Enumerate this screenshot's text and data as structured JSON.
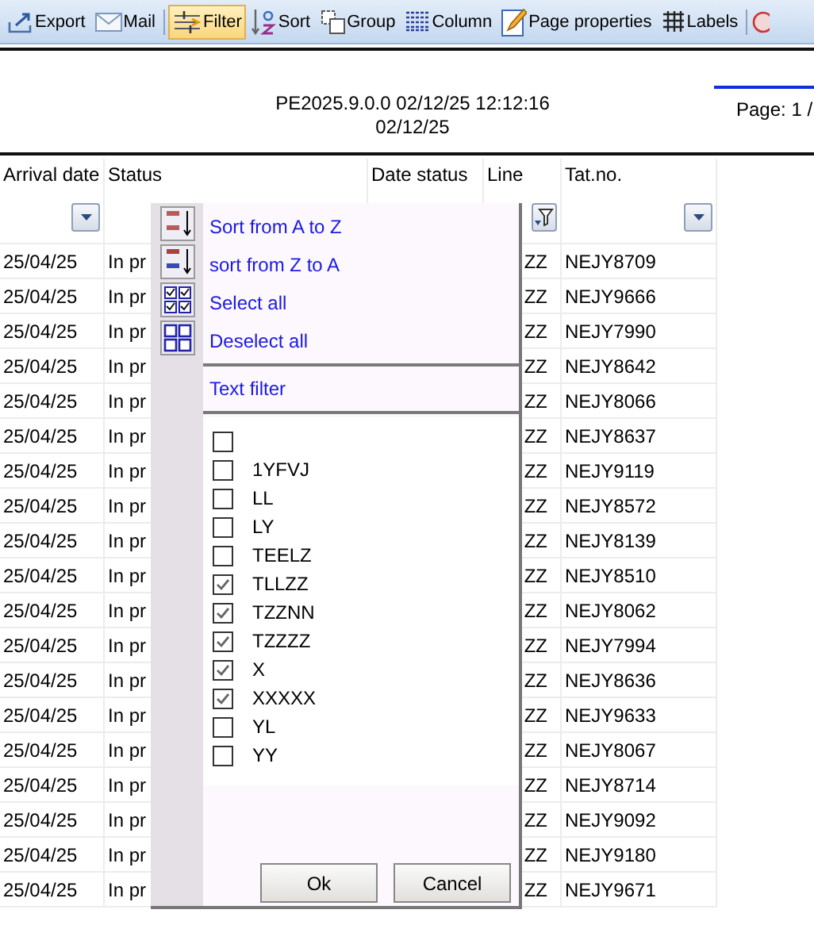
{
  "toolbar": {
    "items": [
      {
        "label": "Export",
        "selected": false
      },
      {
        "label": "Mail",
        "selected": false
      },
      {
        "label": "Filter",
        "selected": true
      },
      {
        "label": "Sort",
        "selected": false
      },
      {
        "label": "Group",
        "selected": false
      },
      {
        "label": "Column",
        "selected": false
      },
      {
        "label": "Page properties",
        "selected": false
      },
      {
        "label": "Labels",
        "selected": false
      }
    ]
  },
  "report_header": {
    "version_line": "PE2025.9.0.0  02/12/25 12:12:16",
    "date": "02/12/25",
    "page": "Page: 1 /"
  },
  "table": {
    "columns": [
      {
        "label": "Arrival date",
        "filter_active": false
      },
      {
        "label": "Status"
      },
      {
        "label": "Date status"
      },
      {
        "label": "Line",
        "filter_active": true
      },
      {
        "label": "Tat.no.",
        "filter_active": false
      }
    ],
    "rows": [
      {
        "arrival": "25/04/25",
        "status": "In pr",
        "line": "ZZ",
        "tat_no": "NEJY8709"
      },
      {
        "arrival": "25/04/25",
        "status": "In pr",
        "line": "ZZ",
        "tat_no": "NEJY9666"
      },
      {
        "arrival": "25/04/25",
        "status": "In pr",
        "line": "ZZ",
        "tat_no": "NEJY7990"
      },
      {
        "arrival": "25/04/25",
        "status": "In pr",
        "line": "ZZ",
        "tat_no": "NEJY8642"
      },
      {
        "arrival": "25/04/25",
        "status": "In pr",
        "line": "ZZ",
        "tat_no": "NEJY8066"
      },
      {
        "arrival": "25/04/25",
        "status": "In pr",
        "line": "ZZ",
        "tat_no": "NEJY8637"
      },
      {
        "arrival": "25/04/25",
        "status": "In pr",
        "line": "ZZ",
        "tat_no": "NEJY9119"
      },
      {
        "arrival": "25/04/25",
        "status": "In pr",
        "line": "ZZ",
        "tat_no": "NEJY8572"
      },
      {
        "arrival": "25/04/25",
        "status": "In pr",
        "line": "ZZ",
        "tat_no": "NEJY8139"
      },
      {
        "arrival": "25/04/25",
        "status": "In pr",
        "line": "ZZ",
        "tat_no": "NEJY8510"
      },
      {
        "arrival": "25/04/25",
        "status": "In pr",
        "line": "ZZ",
        "tat_no": "NEJY8062"
      },
      {
        "arrival": "25/04/25",
        "status": "In pr",
        "line": "ZZ",
        "tat_no": "NEJY7994"
      },
      {
        "arrival": "25/04/25",
        "status": "In pr",
        "line": "ZZ",
        "tat_no": "NEJY8636"
      },
      {
        "arrival": "25/04/25",
        "status": "In pr",
        "line": "ZZ",
        "tat_no": "NEJY9633"
      },
      {
        "arrival": "25/04/25",
        "status": "In pr",
        "line": "ZZ",
        "tat_no": "NEJY8067"
      },
      {
        "arrival": "25/04/25",
        "status": "In pr",
        "line": "ZZ",
        "tat_no": "NEJY8714"
      },
      {
        "arrival": "25/04/25",
        "status": "In pr",
        "line": "ZZ",
        "tat_no": "NEJY9092"
      },
      {
        "arrival": "25/04/25",
        "status": "In pr",
        "line": "ZZ",
        "tat_no": "NEJY9180"
      },
      {
        "arrival": "25/04/25",
        "status": "In pr",
        "line": "ZZ",
        "tat_no": "NEJY9671"
      }
    ]
  },
  "filter_popup": {
    "menu": [
      {
        "label": "Sort from A to Z"
      },
      {
        "label": "sort from Z to A"
      },
      {
        "label": "Select all"
      },
      {
        "label": "Deselect all"
      }
    ],
    "text_filter": "Text filter",
    "values": [
      {
        "checked": false
      },
      {
        "label": "1YFVJ",
        "checked": false
      },
      {
        "label": "LL",
        "checked": false
      },
      {
        "label": "LY",
        "checked": false
      },
      {
        "label": "TEELZ",
        "checked": false
      },
      {
        "label": "TLLZZ",
        "checked": true
      },
      {
        "label": "TZZNN",
        "checked": true
      },
      {
        "label": "TZZZZ",
        "checked": true
      },
      {
        "label": "X",
        "checked": true
      },
      {
        "label": "XXXXX",
        "checked": true
      },
      {
        "label": "YL",
        "checked": false
      },
      {
        "label": "YY",
        "checked": false
      }
    ],
    "buttons": [
      "Ok",
      "Cancel"
    ]
  }
}
